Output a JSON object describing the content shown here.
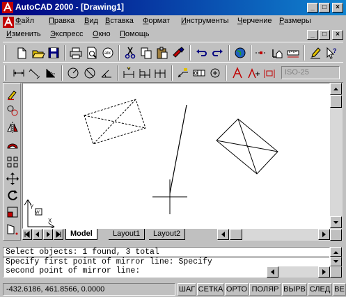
{
  "window": {
    "title": "AutoCAD 2000 - [Drawing1]",
    "controls": {
      "minimize": "_",
      "maximize": "□",
      "close": "×"
    }
  },
  "menu": {
    "row1": [
      {
        "label": "Файл",
        "underline": "Ф",
        "rest": "айл"
      },
      {
        "label": "Правка",
        "underline": "П",
        "rest": "равка"
      },
      {
        "label": "Вид",
        "underline": "В",
        "rest": "ид"
      },
      {
        "label": "Вставка",
        "underline": "В",
        "rest": "ставка"
      },
      {
        "label": "Формат",
        "underline": "Ф",
        "rest": "ормат"
      },
      {
        "label": "Инструменты",
        "underline": "И",
        "rest": "нструменты"
      },
      {
        "label": "Черчение",
        "underline": "Ч",
        "rest": "ерчение"
      },
      {
        "label": "Размеры",
        "underline": "Р",
        "rest": "азмеры"
      }
    ],
    "row2": [
      {
        "label": "Изменить",
        "underline": "И",
        "rest": "зменить"
      },
      {
        "label": "Экспресс",
        "underline": "Э",
        "rest": "кспресс"
      },
      {
        "label": "Окно",
        "underline": "О",
        "rest": "кно"
      },
      {
        "label": "Помощь",
        "underline": "П",
        "rest": "омощь"
      }
    ]
  },
  "dimstyle": {
    "value": "ISO-25"
  },
  "tabs": {
    "model": "Model",
    "layout1": "Layout1",
    "layout2": "Layout2"
  },
  "ucs": {
    "x_label": "X",
    "y_label": "Y",
    "w_label": "W"
  },
  "command": {
    "line1": "Select objects: 1 found, 3 total",
    "line2": "Specify first point of mirror line: Specify",
    "line3": "second point of mirror line:"
  },
  "status": {
    "coords": "-432.6186, 461.8566, 0.0000",
    "snap": "ШАГ",
    "grid": "СЕТКА",
    "ortho": "ОРТО",
    "polar": "ПОЛЯР",
    "osnap": "ВЫРВ",
    "otrack": "СЛЕД",
    "lwt": "ВЕ"
  },
  "colors": {
    "titlebar": "#000080",
    "accent": "#c00000",
    "face": "#c0c0c0"
  }
}
